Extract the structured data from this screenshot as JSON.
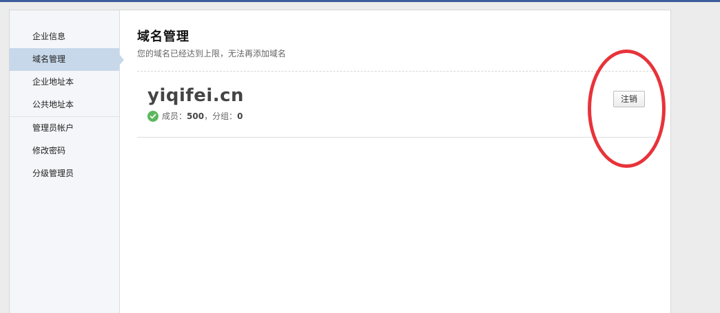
{
  "sidebar": {
    "items": [
      {
        "label": "企业信息"
      },
      {
        "label": "域名管理"
      },
      {
        "label": "企业地址本"
      },
      {
        "label": "公共地址本"
      },
      {
        "label": "管理员帐户"
      },
      {
        "label": "修改密码"
      },
      {
        "label": "分级管理员"
      }
    ],
    "active_index": 1
  },
  "main": {
    "title": "域名管理",
    "subtitle": "您的域名已经达到上限，无法再添加域名",
    "domain": {
      "name": "yiqifei.cn",
      "members_label": "成员：",
      "members": "500",
      "sep": "，",
      "groups_label": "分组：",
      "groups": "0",
      "status_icon": "check-circle-icon",
      "unregister_label": "注销"
    }
  },
  "colors": {
    "top_bar": "#3d5e9e",
    "active_nav": "#c7d8ea",
    "success": "#5cb85c",
    "annotation": "#e8333a"
  }
}
